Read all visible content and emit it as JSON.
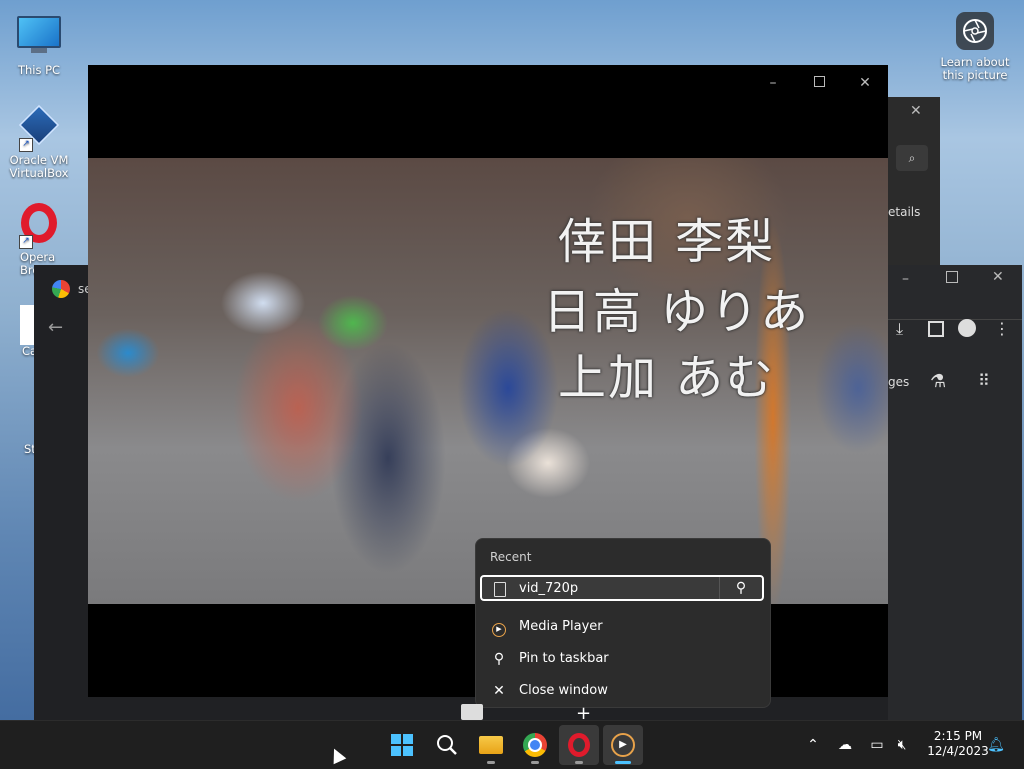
{
  "desktop": {
    "icons": [
      {
        "label": "This PC"
      },
      {
        "label": "Oracle VM VirtualBox"
      },
      {
        "label": "Opera Bro"
      },
      {
        "label": "Ca"
      },
      {
        "label": "St"
      }
    ],
    "learn_label": "Learn about this picture"
  },
  "background": {
    "chrome_tab_text": "se",
    "details_text": "etails",
    "pages_text": "ges"
  },
  "video": {
    "caption_lines": [
      "倖田 李梨",
      "日高 ゆりあ",
      "上加 あむ"
    ]
  },
  "jumplist": {
    "header": "Recent",
    "recent_item": "vid_720p",
    "items": [
      {
        "label": "Media Player",
        "icon": "media-player-icon"
      },
      {
        "label": "Pin to taskbar",
        "icon": "pin-icon"
      },
      {
        "label": "Close window",
        "icon": "close-icon"
      }
    ]
  },
  "taskbar": {
    "time": "2:15 PM",
    "date": "12/4/2023"
  },
  "colors": {
    "accent": "#4cc2ff",
    "opera_red": "#e01b2c",
    "taskbar_bg": "#1f1f1f"
  }
}
